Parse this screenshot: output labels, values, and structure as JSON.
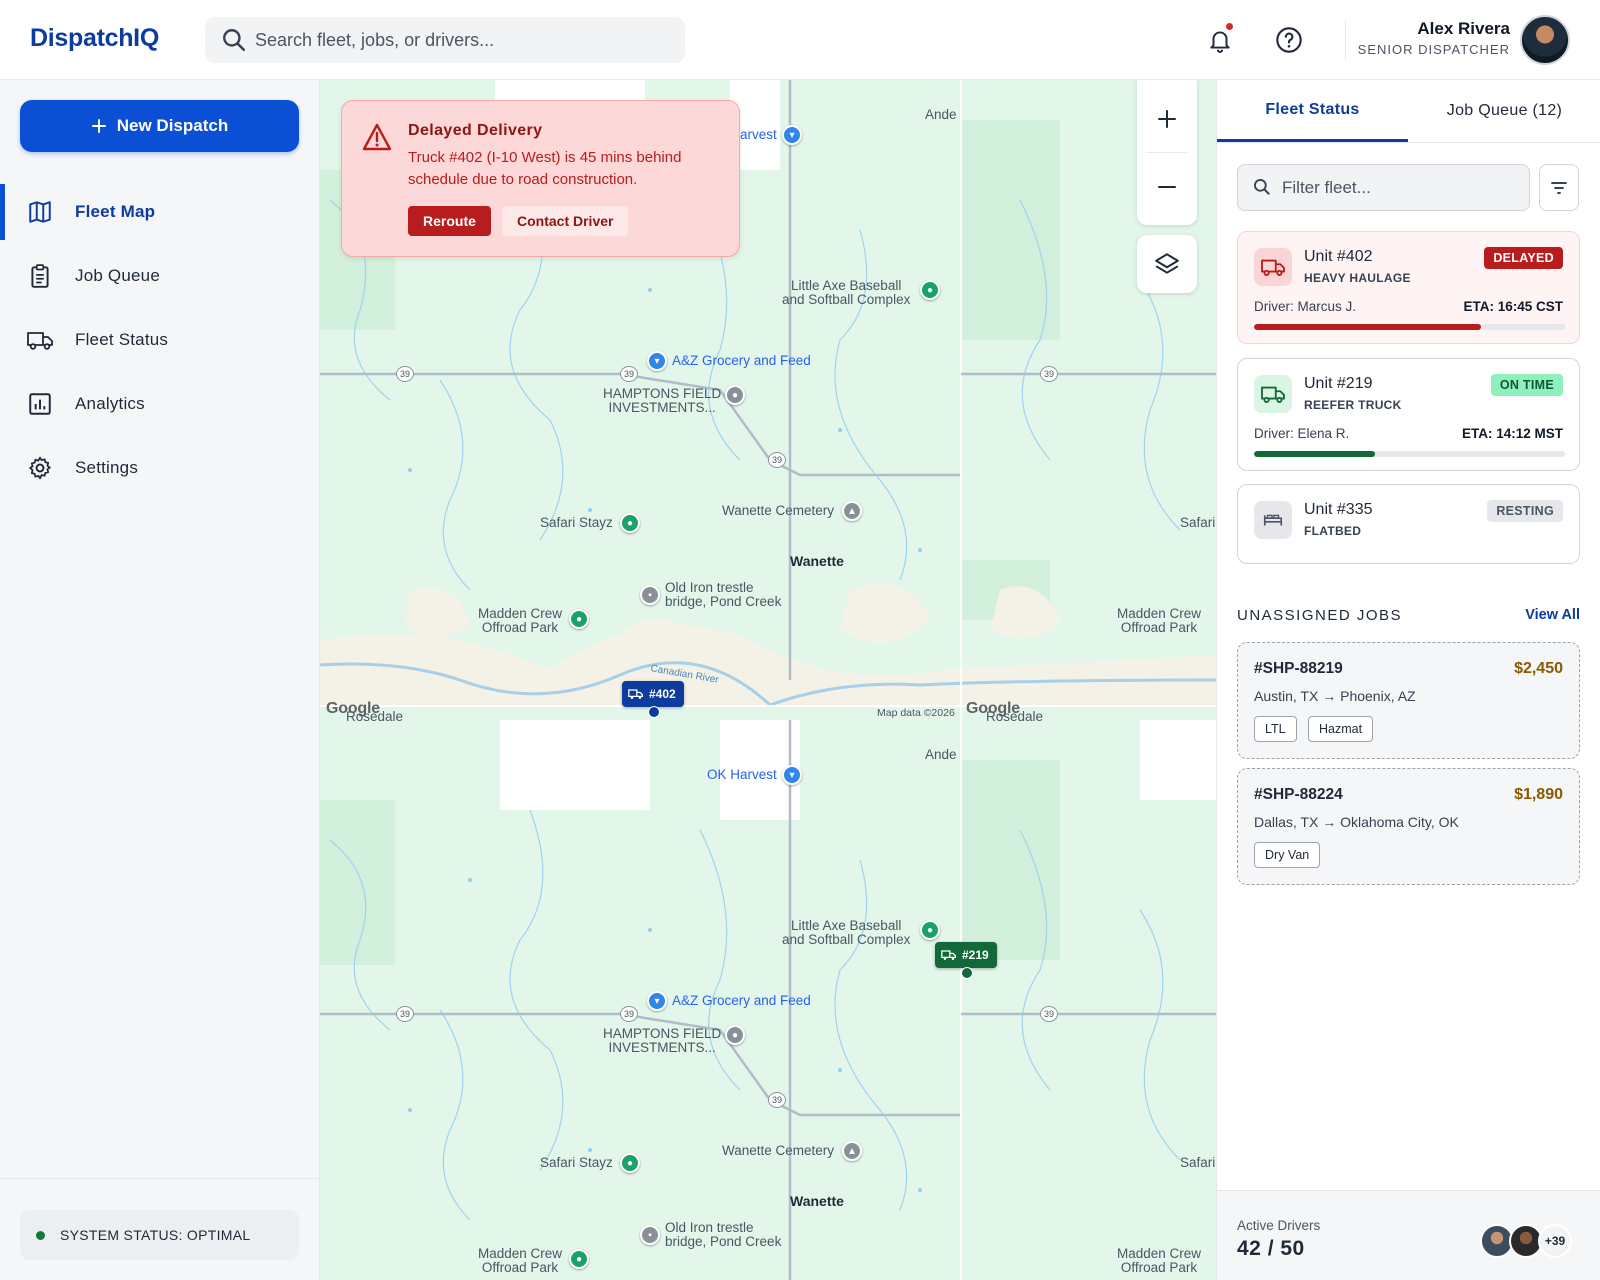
{
  "app": {
    "name": "DispatchIQ"
  },
  "search": {
    "placeholder": "Search fleet, jobs, or drivers..."
  },
  "user": {
    "name": "Alex Rivera",
    "role": "SENIOR DISPATCHER"
  },
  "sidebar": {
    "new_dispatch_label": "New Dispatch",
    "items": [
      {
        "label": "Fleet Map",
        "icon": "map-icon",
        "active": true
      },
      {
        "label": "Job Queue",
        "icon": "clipboard-icon",
        "active": false
      },
      {
        "label": "Fleet Status",
        "icon": "truck-icon",
        "active": false
      },
      {
        "label": "Analytics",
        "icon": "bar-chart-icon",
        "active": false
      },
      {
        "label": "Settings",
        "icon": "gear-icon",
        "active": false
      }
    ],
    "system_status": "SYSTEM STATUS: OPTIMAL"
  },
  "alert": {
    "title": "Delayed Delivery",
    "body": "Truck #402 (I-10 West) is 45 mins behind schedule due to road construction.",
    "primary_action": "Reroute",
    "secondary_action": "Contact Driver"
  },
  "map": {
    "attribution": "Map data ©2026",
    "google_mark": "Google",
    "markers": [
      {
        "label": "#402",
        "color": "#0d3b9e"
      },
      {
        "label": "#219",
        "color": "#11693a"
      }
    ],
    "places": {
      "ande_top": "Ande",
      "harvest_top": "arvest",
      "little_axe_top": "Little Axe Baseball\nand Softball Complex",
      "az_grocery_top": "A&Z Grocery and Feed",
      "hamptons_top": "HAMPTONS FIELD\nINVESTMENTS...",
      "wanette_cem_top": "Wanette Cemetery",
      "safari_top": "Safari Stayz",
      "safari_right_top": "Safari",
      "wanette_top": "Wanette",
      "old_iron_top": "Old Iron trestle\nbridge, Pond Creek",
      "madden_top": "Madden Crew\nOffroad Park",
      "madden_right_top": "Madden Crew\nOffroad Park",
      "canadian_river": "Canadian River",
      "rosedale_left": "Rosedale",
      "rosedale_right": "Rosedale",
      "ande_bottom": "Ande",
      "ok_harvest": "OK Harvest",
      "little_axe_bottom": "Little Axe Baseball\nand Softball Complex",
      "az_grocery_bottom": "A&Z Grocery and Feed",
      "hamptons_bottom": "HAMPTONS FIELD\nINVESTMENTS...",
      "wanette_cem_bottom": "Wanette Cemetery",
      "safari_bottom": "Safari Stayz",
      "safari_right_bottom": "Safari",
      "wanette_bottom": "Wanette",
      "old_iron_bottom": "Old Iron trestle\nbridge, Pond Creek",
      "madden_bottom": "Madden Crew\nOffroad Park",
      "madden_right_bottom": "Madden Crew\nOffroad Park"
    },
    "route_shield": "39"
  },
  "panel": {
    "tabs": [
      {
        "label": "Fleet Status",
        "active": true
      },
      {
        "label": "Job Queue (12)",
        "active": false
      }
    ],
    "filter_placeholder": "Filter fleet...",
    "units": [
      {
        "title": "Unit #402",
        "type": "HEAVY HAULAGE",
        "status": "DELAYED",
        "driver": "Driver: Marcus J.",
        "eta": "ETA: 16:45 CST",
        "progress": 0.73,
        "color": "#b91c1c"
      },
      {
        "title": "Unit #219",
        "type": "REEFER TRUCK",
        "status": "ON TIME",
        "driver": "Driver: Elena R.",
        "eta": "ETA: 14:12 MST",
        "progress": 0.39,
        "color": "#11693a"
      },
      {
        "title": "Unit #335",
        "type": "FLATBED",
        "status": "RESTING"
      }
    ],
    "unassigned_title": "UNASSIGNED JOBS",
    "view_all": "View All",
    "jobs": [
      {
        "id": "#SHP-88219",
        "price": "$2,450",
        "route": "Austin, TX → Phoenix, AZ",
        "tags": [
          "LTL",
          "Hazmat"
        ]
      },
      {
        "id": "#SHP-88224",
        "price": "$1,890",
        "route": "Dallas, TX → Oklahoma City, OK",
        "tags": [
          "Dry Van"
        ]
      }
    ],
    "footer": {
      "label": "Active Drivers",
      "count": "42 / 50",
      "more": "+39"
    }
  }
}
